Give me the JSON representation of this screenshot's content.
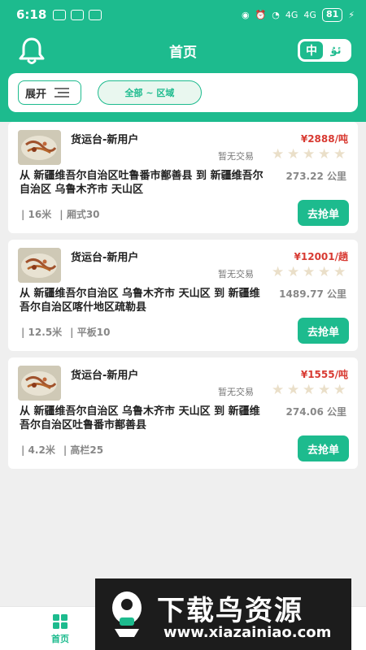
{
  "status_bar": {
    "time": "6:18",
    "battery": "81",
    "signal_a": "4G",
    "signal_b": "4G"
  },
  "header": {
    "title": "首页",
    "lang_zh": "中",
    "lang_ug": "ئۇ"
  },
  "filters": {
    "expand_label": "展开",
    "region_label": "全部 ~ 区域"
  },
  "cards": [
    {
      "title": "货运台-新用户",
      "price": "¥2888/吨",
      "status": "暂无交易",
      "route": "从 新疆维吾尔自治区吐鲁番市鄯善县  到 新疆维吾尔自治区 乌鲁木齐市 天山区",
      "distance": "273.22 公里",
      "specs": [
        "| 16米",
        "| 厢式30"
      ],
      "button": "去抢单",
      "rating": 0
    },
    {
      "title": "货运台-新用户",
      "price": "¥12001/趟",
      "status": "暂无交易",
      "route": "从 新疆维吾尔自治区 乌鲁木齐市 天山区 到  新疆维吾尔自治区喀什地区疏勒县",
      "distance": "1489.77 公里",
      "specs": [
        "| 12.5米",
        "| 平板10"
      ],
      "button": "去抢单",
      "rating": 0
    },
    {
      "title": "货运台-新用户",
      "price": "¥1555/吨",
      "status": "暂无交易",
      "route": "从 新疆维吾尔自治区 乌鲁木齐市 天山区 到  新疆维吾尔自治区吐鲁番市鄯善县",
      "distance": "274.06 公里",
      "specs": [
        "| 4.2米",
        "| 高栏25"
      ],
      "button": "去抢单",
      "rating": 0
    }
  ],
  "bottom_nav": {
    "home_label": "首页"
  },
  "watermark": {
    "title": "下载鸟资源",
    "url": "www.xiazainiao.com"
  },
  "colors": {
    "primary": "#1dbb8e",
    "price": "#d83a32",
    "star_empty": "#eadfc9"
  }
}
